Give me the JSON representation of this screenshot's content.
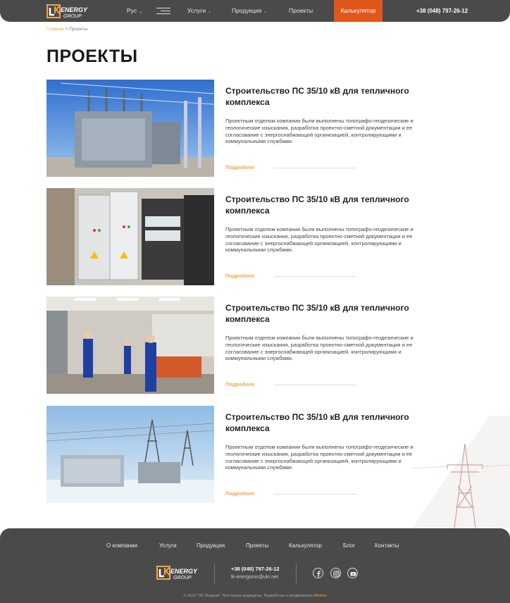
{
  "header": {
    "logo_line1": "ENERGY",
    "logo_line2": "GROUP",
    "lang": "Рус",
    "nav": [
      "Услуги",
      "Продукция",
      "Проекты"
    ],
    "calculator": "Калькулятор",
    "phone": "+38 (048) 797-26-12"
  },
  "breadcrumb": {
    "home": "Главная",
    "separator": ">",
    "current": "Проекты"
  },
  "page_title": "ПРОЕКТЫ",
  "projects": [
    {
      "title": "Строительство ПС 35/10 кВ для тепличного комплекса",
      "description": "Проектным отделом компании были выполнены топографо-геодезические и геологические изыскания, разработка проектно-сметной документации и ее согласование с энергоснабжающей организацией, контролирующими и коммунальными службами.",
      "more": "Подробнее"
    },
    {
      "title": "Строительство ПС 35/10 кВ для тепличного комплекса",
      "description": "Проектным отделом компании были выполнены топографо-геодезические и геологические изыскания, разработка проектно-сметной документации и ее согласование с энергоснабжающей организацией, контролирующими и коммунальными службами.",
      "more": "Подробнее"
    },
    {
      "title": "Строительство ПС 35/10 кВ для тепличного комплекса",
      "description": "Проектным отделом компании были выполнены топографо-геодезические и геологические изыскания, разработка проектно-сметной документации и ее согласование с энергоснабжающей организацией, контролирующими и коммунальными службами.",
      "more": "Подробнее"
    },
    {
      "title": "Строительство ПС 35/10 кВ для тепличного комплекса",
      "description": "Проектным отделом компании были выполнены топографо-геодезические и геологические изыскания, разработка проектно-сметной документации и ее согласование с энергоснабжающей организацией, контролирующими и коммунальными службами.",
      "more": "Подробнее"
    }
  ],
  "footer": {
    "nav": [
      "О компании",
      "Услуги",
      "Продукция",
      "Проекты",
      "Калькулятор",
      "Блог",
      "Контакты"
    ],
    "phone": "+38 (048) 797-26-12",
    "email": "lk-energomir@ukr.net",
    "social": [
      "facebook-icon",
      "instagram-icon",
      "youtube-icon"
    ],
    "copyright": "© 2019 \"ЛК Энергия\". Все права защищены. Разработка и продвижение",
    "developer": "Mobios"
  },
  "colors": {
    "header_bg": "#4a4a4a",
    "accent": "#e0571c",
    "link": "#f0a54a"
  }
}
